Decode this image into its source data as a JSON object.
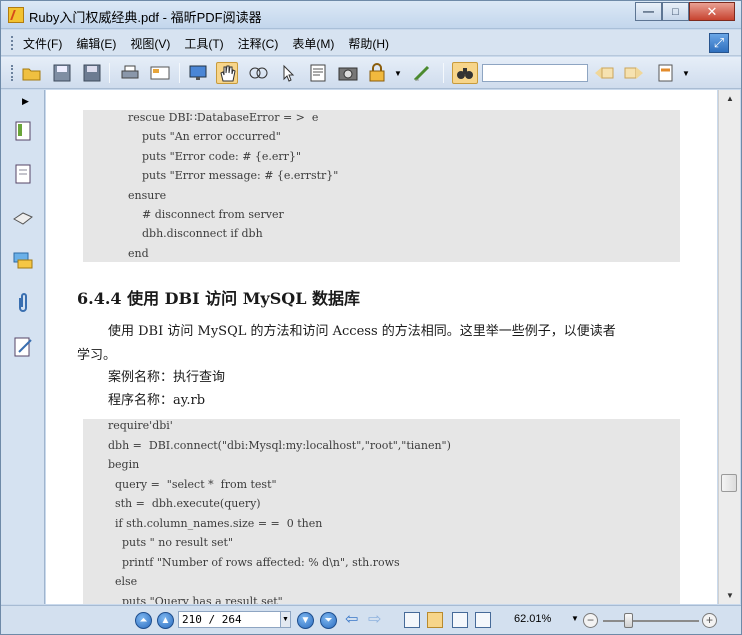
{
  "window": {
    "title": "Ruby入门权威经典.pdf - 福昕PDF阅读器",
    "buttons": {
      "minimize": "—",
      "maximize": "□",
      "close": "✕"
    }
  },
  "menu": {
    "items": [
      "文件(F)",
      "编辑(E)",
      "视图(V)",
      "工具(T)",
      "注释(C)",
      "表单(M)",
      "帮助(H)"
    ]
  },
  "toolbar": {
    "find_value": "",
    "icons": [
      "open-folder-icon",
      "save-icon",
      "save-as-icon",
      "print-icon",
      "properties-icon",
      "fullscreen-icon",
      "hand-tool-icon",
      "zoom-glass-icon",
      "select-arrow-icon",
      "text-select-icon",
      "snapshot-icon",
      "rms-lock-icon",
      "sign-icon",
      "binoculars-icon",
      "find-prev-icon",
      "find-next-icon",
      "highlight-icon"
    ]
  },
  "left_panel": {
    "icons": [
      "bookmarks-icon",
      "pages-icon",
      "layers-icon",
      "comments-icon",
      "attachments-icon",
      "signature-icon"
    ]
  },
  "document": {
    "code_block_1": [
      "rescue DBI∷DatabaseError = >  e",
      "    puts \"An error occurred\"",
      "    puts \"Error code: # {e.err}\"",
      "    puts \"Error message: # {e.errstr}\"",
      "ensure",
      "    # disconnect from server",
      "    dbh.disconnect if dbh",
      "end"
    ],
    "heading": "6.4.4   使用 DBI 访问 MySQL 数据库",
    "paragraph_line1": "使用 DBI 访问 MySQL 的方法和访问 Access 的方法相同。这里举一些例子，以便读者",
    "paragraph_line2": "学习。",
    "case_name": "案例名称：执行查询",
    "program_name": "程序名称：ay.rb",
    "code_block_2": [
      "require'dbi'",
      "dbh =  DBI.connect(\"dbi:Mysql:my:localhost\",\"root\",\"tianen\")",
      "begin",
      "  query =  \"select *  from test\"",
      "  sth =  dbh.execute(query)",
      "  if sth.column_names.size = =  0 then",
      "    puts \" no result set\"",
      "    printf \"Number of rows affected: % d\\n\", sth.rows",
      "  else",
      "    puts \"Query has a result set\""
    ]
  },
  "statusbar": {
    "page_value": "210 / 264",
    "zoom_value": "62.01%",
    "zoom_minus": "−",
    "zoom_plus": "+"
  }
}
